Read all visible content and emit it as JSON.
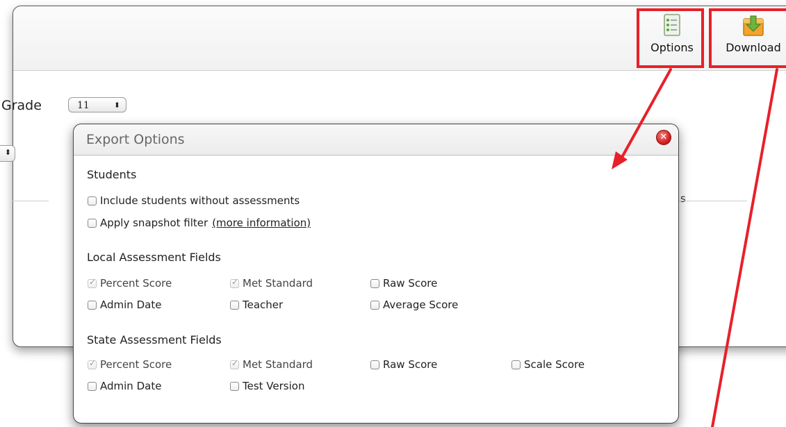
{
  "toolbar": {
    "options_label": "Options",
    "download_label": "Download",
    "options_icon": "list-document-icon",
    "download_icon": "download-box-icon"
  },
  "filters": {
    "grade_label": "Grade",
    "grade_value": "11"
  },
  "background": {
    "column_fragment": "s"
  },
  "modal": {
    "title": "Export Options",
    "students": {
      "heading": "Students",
      "options": [
        {
          "label": "Include students without assessments",
          "checked": false
        },
        {
          "label": "Apply snapshot filter",
          "checked": false,
          "link": "(more information)"
        }
      ]
    },
    "local": {
      "heading": "Local Assessment Fields",
      "fields": [
        {
          "label": "Percent Score",
          "checked": true,
          "disabled": true
        },
        {
          "label": "Met Standard",
          "checked": true,
          "disabled": true
        },
        {
          "label": "Raw Score",
          "checked": false
        },
        {
          "label": "Admin Date",
          "checked": false
        },
        {
          "label": "Teacher",
          "checked": false
        },
        {
          "label": "Average Score",
          "checked": false
        }
      ]
    },
    "state": {
      "heading": "State Assessment Fields",
      "fields": [
        {
          "label": "Percent Score",
          "checked": true,
          "disabled": true
        },
        {
          "label": "Met Standard",
          "checked": true,
          "disabled": true
        },
        {
          "label": "Raw Score",
          "checked": false
        },
        {
          "label": "Scale Score",
          "checked": false
        },
        {
          "label": "Admin Date",
          "checked": false
        },
        {
          "label": "Test Version",
          "checked": false
        }
      ]
    }
  },
  "colors": {
    "annotation": "#e8202a",
    "close": "#d42020"
  }
}
